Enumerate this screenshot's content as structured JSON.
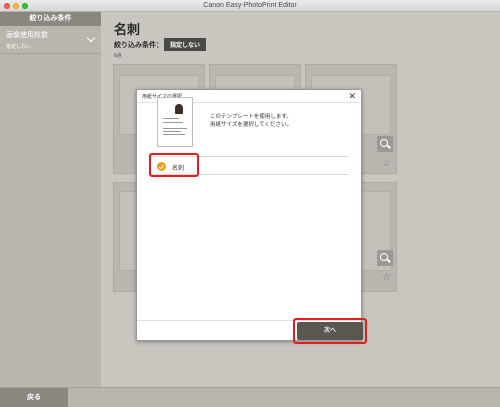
{
  "window": {
    "title": "Canon Easy-PhotoPrint Editor"
  },
  "sidebar": {
    "header": "絞り込み条件",
    "filter": {
      "title": "画像使用枚数",
      "value": "指定しない"
    }
  },
  "main": {
    "title": "名刺",
    "criteria_label": "絞り込み条件：",
    "criteria_value": "指定しない",
    "count": "6点"
  },
  "modal": {
    "title": "用紙サイズの選択",
    "close": "✕",
    "message_line1": "このテンプレートを使用します。",
    "message_line2": "用紙サイズを選択してください。",
    "option_label": "名刺",
    "next_label": "次へ"
  },
  "footer": {
    "back_label": "戻る"
  },
  "icons": {
    "close": "close-icon",
    "search": "search-icon",
    "favorite": "star-icon",
    "checked": "check-icon"
  },
  "colors": {
    "accent": "#f39a1d",
    "highlight": "#e01f1f",
    "button": "#5b5750"
  }
}
